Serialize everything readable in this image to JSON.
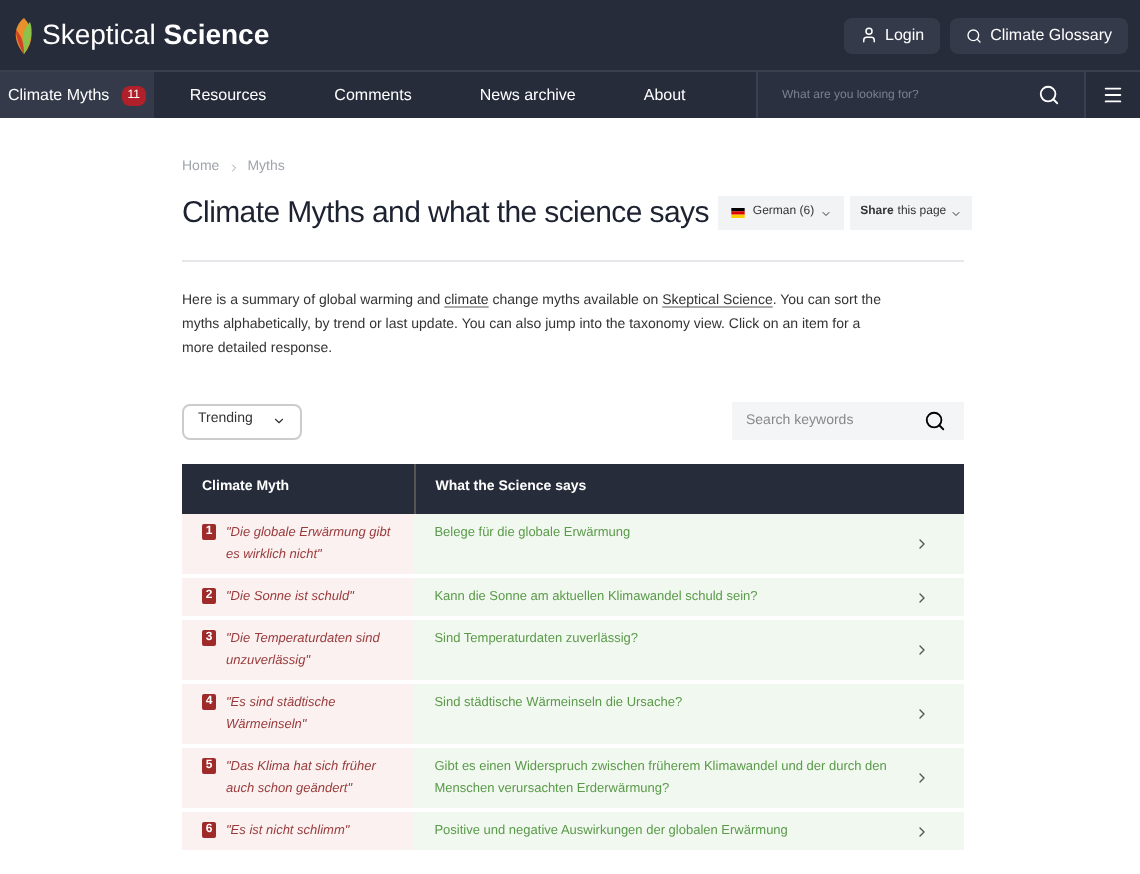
{
  "header": {
    "brand_light": "Skeptical",
    "brand_bold": "Science",
    "login": "Login",
    "glossary": "Climate Glossary"
  },
  "nav": {
    "items": [
      {
        "label": "Climate Myths",
        "badge": "11",
        "selected": true
      },
      {
        "label": "Resources",
        "selected": false
      },
      {
        "label": "Comments",
        "selected": false
      },
      {
        "label": "News archive",
        "selected": false
      },
      {
        "label": "About",
        "selected": false
      }
    ],
    "search_placeholder": "What are you looking for?"
  },
  "breadcrumb": [
    "Home",
    "Myths"
  ],
  "title": "Climate Myths and what the science says",
  "language": "German (6)",
  "share": {
    "bold": "Share",
    "rest": "this page"
  },
  "intro": [
    {
      "text": "Here is a summary of global warming and ",
      "link": false
    },
    {
      "text": "climate",
      "link": true
    },
    {
      "text": " change myths available on ",
      "link": false
    },
    {
      "text": "Skeptical Science",
      "link": true
    },
    {
      "text": ". You can sort the myths alphabetically, by trend or last update. You can also jump into the taxonomy view. Click on an item for a more detailed response.",
      "link": false
    }
  ],
  "sort": "Trending",
  "search_placeholder": "Search keywords",
  "table": {
    "columns": [
      "Climate Myth",
      "What the Science says"
    ],
    "rows": [
      {
        "rank": "1",
        "myth": "\"Die globale Erwärmung gibt es wirklich nicht\"",
        "science": "Belege für die globale Erwärmung"
      },
      {
        "rank": "2",
        "myth": "\"Die Sonne ist schuld\"",
        "science": "Kann die Sonne am aktuellen Klimawandel schuld sein?"
      },
      {
        "rank": "3",
        "myth": "\"Die Temperaturdaten sind unzuverlässig\"",
        "science": "Sind Temperaturdaten zuverlässig?"
      },
      {
        "rank": "4",
        "myth": "\"Es sind städtische Wärmeinseln\"",
        "science": "Sind städtische Wärmeinseln die Ursache?"
      },
      {
        "rank": "5",
        "myth": "\"Das Klima hat sich früher auch schon geändert\"",
        "science": "Gibt es einen Widerspruch zwischen früherem Klimawandel und der durch den Menschen verursachten Erderwärmung?"
      },
      {
        "rank": "6",
        "myth": "\"Es ist nicht schlimm\"",
        "science": "Positive und negative Auswirkungen der globalen Erwärmung"
      }
    ]
  }
}
